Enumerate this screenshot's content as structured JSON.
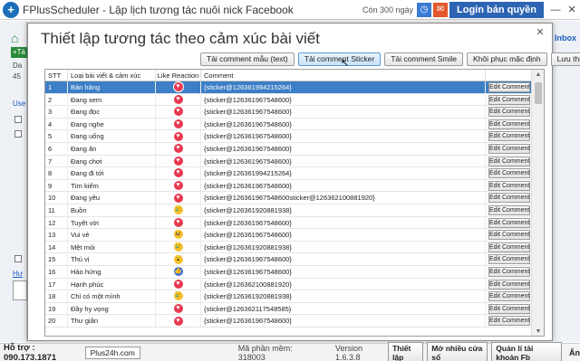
{
  "app": {
    "title": "FPlusScheduler - Lập lịch tương tác nuôi nick Facebook",
    "days_left": "Còn 300 ngày",
    "login_label": "Login bản quyền",
    "logo_glyph": "+"
  },
  "background": {
    "tab_label": "+Tá",
    "inbox_label": "Inbox"
  },
  "dialog": {
    "title": "Thiết lập tương tác theo cảm xúc bài viết",
    "buttons": [
      "Tải comment mẫu (text)",
      "Tải comment Sticker",
      "Tải comment Smile",
      "Khôi phục mặc định",
      "Lưu thiết lập"
    ],
    "columns": [
      "STT",
      "Loại bài viết & cảm xúc",
      "Like Reaction",
      "Comment",
      ""
    ],
    "edit_label": "Edit Comment",
    "rows": [
      {
        "stt": "1",
        "cat": "Bán hàng",
        "react": "love",
        "comment": "{sticker@126361994215264}"
      },
      {
        "stt": "2",
        "cat": "Đang xem",
        "react": "love",
        "comment": "{sticker@126361967548600}"
      },
      {
        "stt": "3",
        "cat": "Đang đọc",
        "react": "love",
        "comment": "{sticker@126361967548600}"
      },
      {
        "stt": "4",
        "cat": "Đang nghe",
        "react": "love",
        "comment": "{sticker@126361967548600}"
      },
      {
        "stt": "5",
        "cat": "Đang uống",
        "react": "love",
        "comment": "{sticker@126361967548600}"
      },
      {
        "stt": "6",
        "cat": "Đang ăn",
        "react": "love",
        "comment": "{sticker@126361967548600}"
      },
      {
        "stt": "7",
        "cat": "Đang chơi",
        "react": "love",
        "comment": "{sticker@126361967548600}"
      },
      {
        "stt": "8",
        "cat": "Đang đi tới",
        "react": "love",
        "comment": "{sticker@126361994215264}"
      },
      {
        "stt": "9",
        "cat": "Tìm kiếm",
        "react": "love",
        "comment": "{sticker@126361967548600}"
      },
      {
        "stt": "10",
        "cat": "Đang yêu",
        "react": "love",
        "comment": "{sticker@126361967548600sticker@126362100881920}"
      },
      {
        "stt": "11",
        "cat": "Buồn",
        "react": "sad",
        "comment": "{sticker@126361920881938}"
      },
      {
        "stt": "12",
        "cat": "Tuyệt vời",
        "react": "love",
        "comment": "{sticker@126361967548600}"
      },
      {
        "stt": "13",
        "cat": "Vui vẻ",
        "react": "haha",
        "comment": "{sticker@126361967548600}"
      },
      {
        "stt": "14",
        "cat": "Mệt mỏi",
        "react": "sad",
        "comment": "{sticker@126361920881938}"
      },
      {
        "stt": "15",
        "cat": "Thú vị",
        "react": "wow",
        "comment": "{sticker@126361967548600}"
      },
      {
        "stt": "16",
        "cat": "Háo hứng",
        "react": "like",
        "comment": "{sticker@126361967548600}"
      },
      {
        "stt": "17",
        "cat": "Hạnh phúc",
        "react": "love",
        "comment": "{sticker@126362100881920}"
      },
      {
        "stt": "18",
        "cat": "Chỉ có một mình",
        "react": "sad",
        "comment": "{sticker@126361920881938}"
      },
      {
        "stt": "19",
        "cat": "Đầy hy vọng",
        "react": "love",
        "comment": "{sticker@126362117548585}"
      },
      {
        "stt": "20",
        "cat": "Thư giãn",
        "react": "love",
        "comment": "{sticker@126361967548600}"
      }
    ]
  },
  "status": {
    "hotline": "Hỗ trợ : 090.173.1871",
    "site": "Plus24h.com",
    "code": "Mã phần mềm: 318003",
    "version": "Version 1.6.3.8",
    "btn_setup": "Thiết lập",
    "btn_multi": "Mở nhiều cửa sổ",
    "btn_accounts": "Quản lí tài khoản Fb",
    "btn_hide": "Ẩn"
  },
  "colors": {
    "accent": "#2d64b3",
    "selection": "#3c7fc6",
    "love": "#e8384f",
    "like": "#3b6fdc",
    "emoji": "#f6c12c"
  },
  "icons": {
    "love": "♥",
    "like": "👍",
    "sad": "😢",
    "haha": "😆",
    "wow": "😮"
  }
}
